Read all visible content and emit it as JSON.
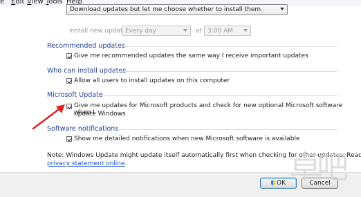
{
  "menu": {
    "items": [
      {
        "key": "E",
        "rest": "dit"
      },
      {
        "key": "V",
        "rest": "iew"
      },
      {
        "key": "T",
        "rest": "ools"
      },
      {
        "key": "H",
        "rest": "elp"
      }
    ],
    "edge_fragment": "e"
  },
  "important_updates": {
    "selected": "Download updates but let me choose whether to install them"
  },
  "schedule": {
    "label": "Install new updates:",
    "day": "Every day",
    "at_label": "at",
    "time": "3:00 AM"
  },
  "sections": {
    "recommended": {
      "heading": "Recommended updates",
      "checkbox_label": "Give me recommended updates the same way I receive important updates",
      "checked": true
    },
    "who_can_install": {
      "heading": "Who can install updates",
      "checkbox_label": "Allow all users to install updates on this computer",
      "checked": true
    },
    "microsoft_update": {
      "heading": "Microsoft Update",
      "checkbox_label_line1": "Give me updates for Microsoft products and check for new optional Microsoft software when I",
      "checkbox_label_line2": "update Windows",
      "checked": true
    },
    "software_notifications": {
      "heading": "Software notifications",
      "checkbox_label": "Show me detailed notifications when new Microsoft software is available",
      "checked": true
    }
  },
  "note": {
    "line1": "Note: Windows Update might update itself automatically first when checking for other updates.  Read our",
    "link": "privacy statement online",
    "link_suffix": "."
  },
  "buttons": {
    "ok": "OK",
    "cancel": "Cancel"
  },
  "watermark": "卓吧",
  "colors": {
    "heading": "#1f3f9a",
    "link": "#1a4fd8",
    "arrow": "#e0201b"
  }
}
